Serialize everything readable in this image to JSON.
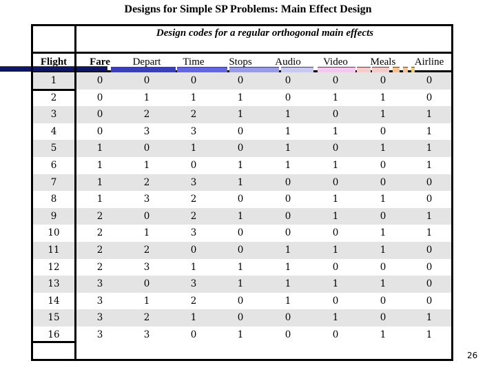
{
  "title": "Designs for Simple SP Problems: Main Effect Design",
  "caption": "Design codes for a regular orthogonal main effects",
  "columns": [
    "Flight",
    "Fare",
    "Depart",
    "Time",
    "Stops",
    "Audio",
    "Video",
    "Meals",
    "Airline"
  ],
  "rows": [
    [
      "1",
      "0",
      "0",
      "0",
      "0",
      "0",
      "0",
      "0",
      "0"
    ],
    [
      "2",
      "0",
      "1",
      "1",
      "1",
      "0",
      "1",
      "1",
      "0"
    ],
    [
      "3",
      "0",
      "2",
      "2",
      "1",
      "1",
      "0",
      "1",
      "1"
    ],
    [
      "4",
      "0",
      "3",
      "3",
      "0",
      "1",
      "1",
      "0",
      "1"
    ],
    [
      "5",
      "1",
      "0",
      "1",
      "0",
      "1",
      "0",
      "1",
      "1"
    ],
    [
      "6",
      "1",
      "1",
      "0",
      "1",
      "1",
      "1",
      "0",
      "1"
    ],
    [
      "7",
      "1",
      "2",
      "3",
      "1",
      "0",
      "0",
      "0",
      "0"
    ],
    [
      "8",
      "1",
      "3",
      "2",
      "0",
      "0",
      "1",
      "1",
      "0"
    ],
    [
      "9",
      "2",
      "0",
      "2",
      "1",
      "0",
      "1",
      "0",
      "1"
    ],
    [
      "10",
      "2",
      "1",
      "3",
      "0",
      "0",
      "0",
      "1",
      "1"
    ],
    [
      "11",
      "2",
      "2",
      "0",
      "0",
      "1",
      "1",
      "1",
      "0"
    ],
    [
      "12",
      "2",
      "3",
      "1",
      "1",
      "1",
      "0",
      "0",
      "0"
    ],
    [
      "13",
      "3",
      "0",
      "3",
      "1",
      "1",
      "1",
      "1",
      "0"
    ],
    [
      "14",
      "3",
      "1",
      "2",
      "0",
      "1",
      "0",
      "0",
      "0"
    ],
    [
      "15",
      "3",
      "2",
      "1",
      "0",
      "0",
      "1",
      "0",
      "1"
    ],
    [
      "16",
      "3",
      "3",
      "0",
      "1",
      "0",
      "0",
      "1",
      "1"
    ]
  ],
  "decorative_bar_colors": [
    "#0d1566",
    "#0d1566",
    "#3a3fb8",
    "#6466e0",
    "#9a9be6",
    "#c8c9f0",
    "#f4c8ef",
    "#f5cccc",
    "#f5c290",
    "#f5c870"
  ],
  "page_number": "26"
}
